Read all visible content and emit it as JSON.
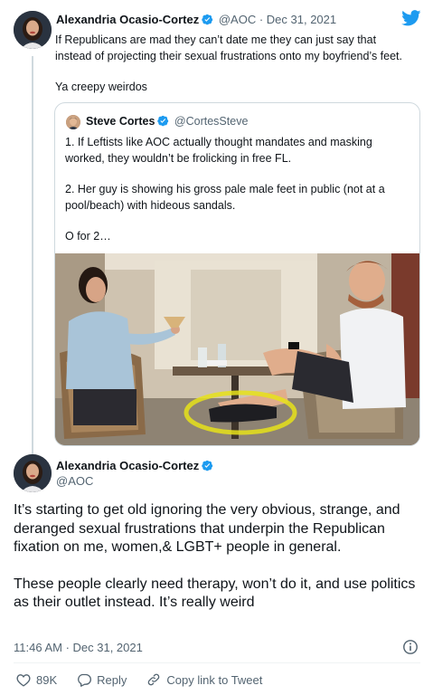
{
  "tweet": {
    "author_name": "Alexandria Ocasio-Cortez",
    "handle": "@AOC",
    "separator": " · ",
    "date": "Dec 31, 2021",
    "paragraphs": [
      "If Republicans are mad they can’t date me they can just say that\ninstead of projecting their sexual frustrations onto my boyfriend’s feet.",
      "Ya creepy weirdos"
    ]
  },
  "quoted_tweet": {
    "author_name": "Steve Cortes",
    "handle": "@CortesSteve",
    "paragraphs": [
      "1. If Leftists like AOC actually thought mandates and masking worked, they wouldn’t be frolicking in free FL.",
      "2. Her guy is showing his gross pale male feet in public (not at a pool/beach) with hideous sandals.",
      "O for 2…"
    ]
  },
  "reply": {
    "author_name": "Alexandria Ocasio-Cortez",
    "handle": "@AOC",
    "paragraphs": [
      "It’s starting to get old ignoring the very obvious, strange, and deranged sexual frustrations that underpin the Republican fixation on me, women,& LGBT+ people in general.",
      "These people clearly need therapy, won’t do it, and use politics as their outlet instead. It’s really weird"
    ],
    "timestamp": "11:46 AM · Dec 31, 2021"
  },
  "actions": {
    "like_count": "89K",
    "reply_label": "Reply",
    "copy_label": "Copy link to Tweet"
  },
  "colors": {
    "twitter_blue": "#1d9bf0",
    "text_secondary": "#536471",
    "border": "#cfd9de",
    "highlight_circle": "#e6e21a"
  },
  "icons": [
    "verified-badge-icon",
    "twitter-bird-icon",
    "info-icon",
    "heart-icon",
    "reply-bubble-icon",
    "link-icon"
  ]
}
